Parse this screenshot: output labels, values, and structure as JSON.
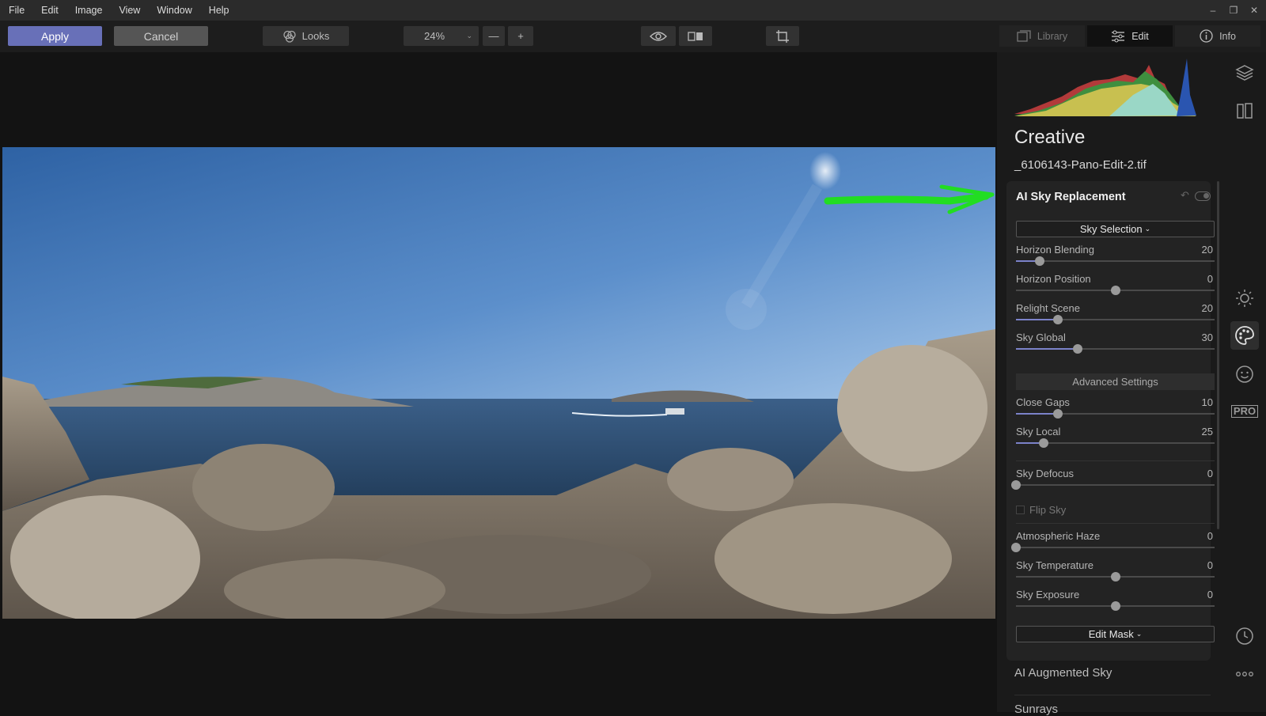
{
  "menu": [
    "File",
    "Edit",
    "Image",
    "View",
    "Window",
    "Help"
  ],
  "window_controls": [
    "–",
    "❐",
    "✕"
  ],
  "toolbar": {
    "apply_label": "Apply",
    "cancel_label": "Cancel",
    "looks_label": "Looks",
    "zoom_value": "24%",
    "zoom_out": "—",
    "zoom_in": "+"
  },
  "tabs": {
    "library": "Library",
    "edit": "Edit",
    "info": "Info"
  },
  "panel": {
    "title": "Creative",
    "file_name": "_6106143-Pano-Edit-2.tif",
    "module": {
      "title": "AI Sky Replacement",
      "sky_selection_label": "Sky Selection",
      "advanced_settings_label": "Advanced Settings",
      "edit_mask_label": "Edit Mask",
      "flip_sky_label": "Flip Sky",
      "sliders": [
        {
          "label": "Horizon Blending",
          "value": "20",
          "position": 0.12,
          "bipolar": false
        },
        {
          "label": "Horizon Position",
          "value": "0",
          "position": 0.5,
          "bipolar": true
        },
        {
          "label": "Relight Scene",
          "value": "20",
          "position": 0.21,
          "bipolar": false
        },
        {
          "label": "Sky Global",
          "value": "30",
          "position": 0.31,
          "bipolar": false
        },
        {
          "label": "Close Gaps",
          "value": "10",
          "position": 0.21,
          "bipolar": false
        },
        {
          "label": "Sky Local",
          "value": "25",
          "position": 0.14,
          "bipolar": false
        },
        {
          "label": "Sky Defocus",
          "value": "0",
          "position": 0.0,
          "bipolar": false
        },
        {
          "label": "Atmospheric Haze",
          "value": "0",
          "position": 0.0,
          "bipolar": false
        },
        {
          "label": "Sky Temperature",
          "value": "0",
          "position": 0.5,
          "bipolar": true
        },
        {
          "label": "Sky Exposure",
          "value": "0",
          "position": 0.5,
          "bipolar": true
        }
      ]
    },
    "next_modules": [
      "AI Augmented Sky",
      "Sunrays"
    ]
  },
  "colors": {
    "accent": "#6870b8",
    "slider_fill": "#7b82c9",
    "annotation_arrow": "#22dd22"
  },
  "side_icons": [
    "layers-icon",
    "presets-icon",
    "essentials-icon",
    "creative-icon",
    "portrait-icon",
    "pro-icon",
    "history-icon",
    "more-icon"
  ],
  "side_icon_pro_label": "PRO"
}
